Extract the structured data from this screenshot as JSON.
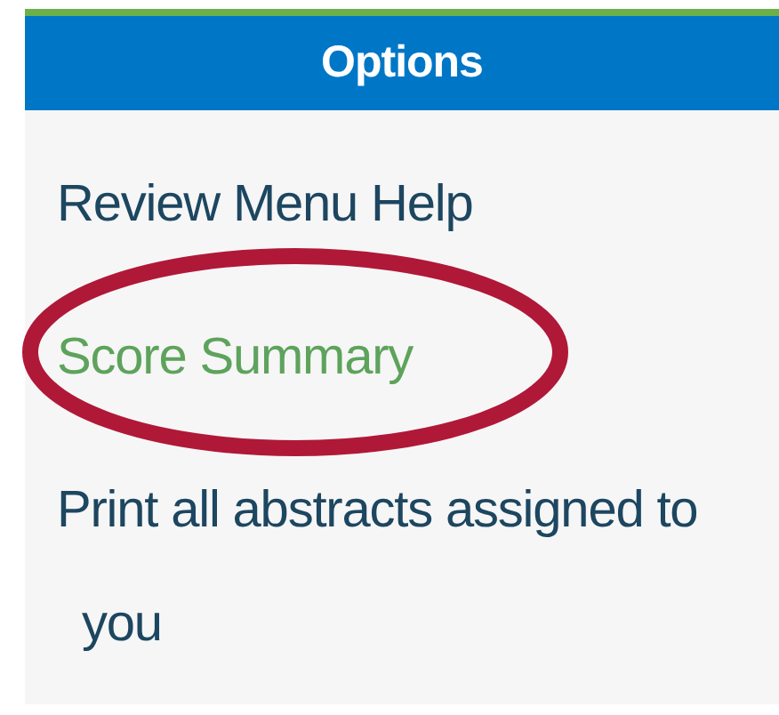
{
  "panel": {
    "title": "Options",
    "items": [
      {
        "label": "Review Menu Help",
        "selected": false
      },
      {
        "label": "Score Summary",
        "selected": true
      },
      {
        "label": "Print all abstracts assigned to you",
        "selected": false
      }
    ]
  },
  "annotation": {
    "kind": "ellipse",
    "color": "#b01838"
  }
}
